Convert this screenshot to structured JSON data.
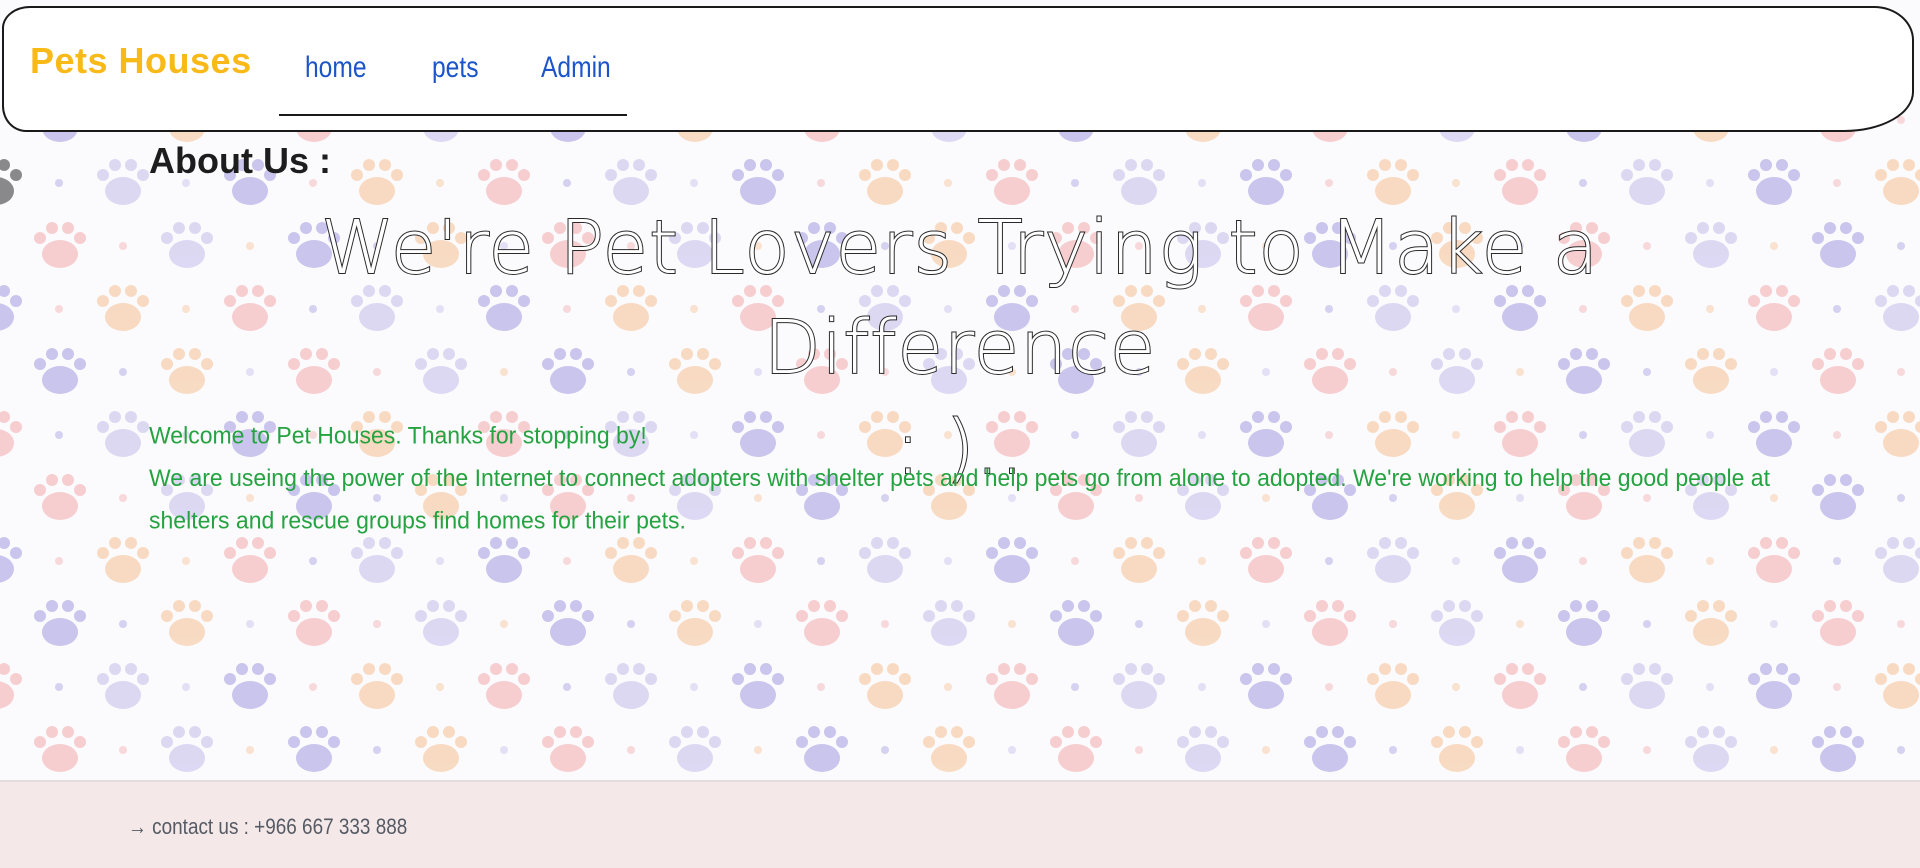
{
  "header": {
    "brand": "Pets Houses",
    "nav": [
      {
        "label": "home"
      },
      {
        "label": "pets"
      },
      {
        "label": "Admin"
      }
    ]
  },
  "main": {
    "section_label": "About Us :",
    "headline_line1": "We're Pet Lovers Trying to Make a Difference",
    "headline_line2": ": )..",
    "intro_line1": "Welcome to Pet Houses. Thanks for stopping by!",
    "intro_line2": "We are useing the power of the Internet to connect adopters with shelter pets and help pets go from alone to adopted. We're working to help the good people at shelters and rescue groups find homes for their pets."
  },
  "footer": {
    "contact": "→ contact us : +966 667 333 888"
  },
  "colors": {
    "brand": "#f9b919",
    "nav_link": "#1b55c9",
    "intro_text": "#25a341",
    "footer_bg": "#f4e9e8",
    "paw_purple": "#8f86d9",
    "paw_pink": "#f29a9a",
    "paw_peach": "#f5b57c",
    "paw_lavender": "#b7b0e6"
  }
}
